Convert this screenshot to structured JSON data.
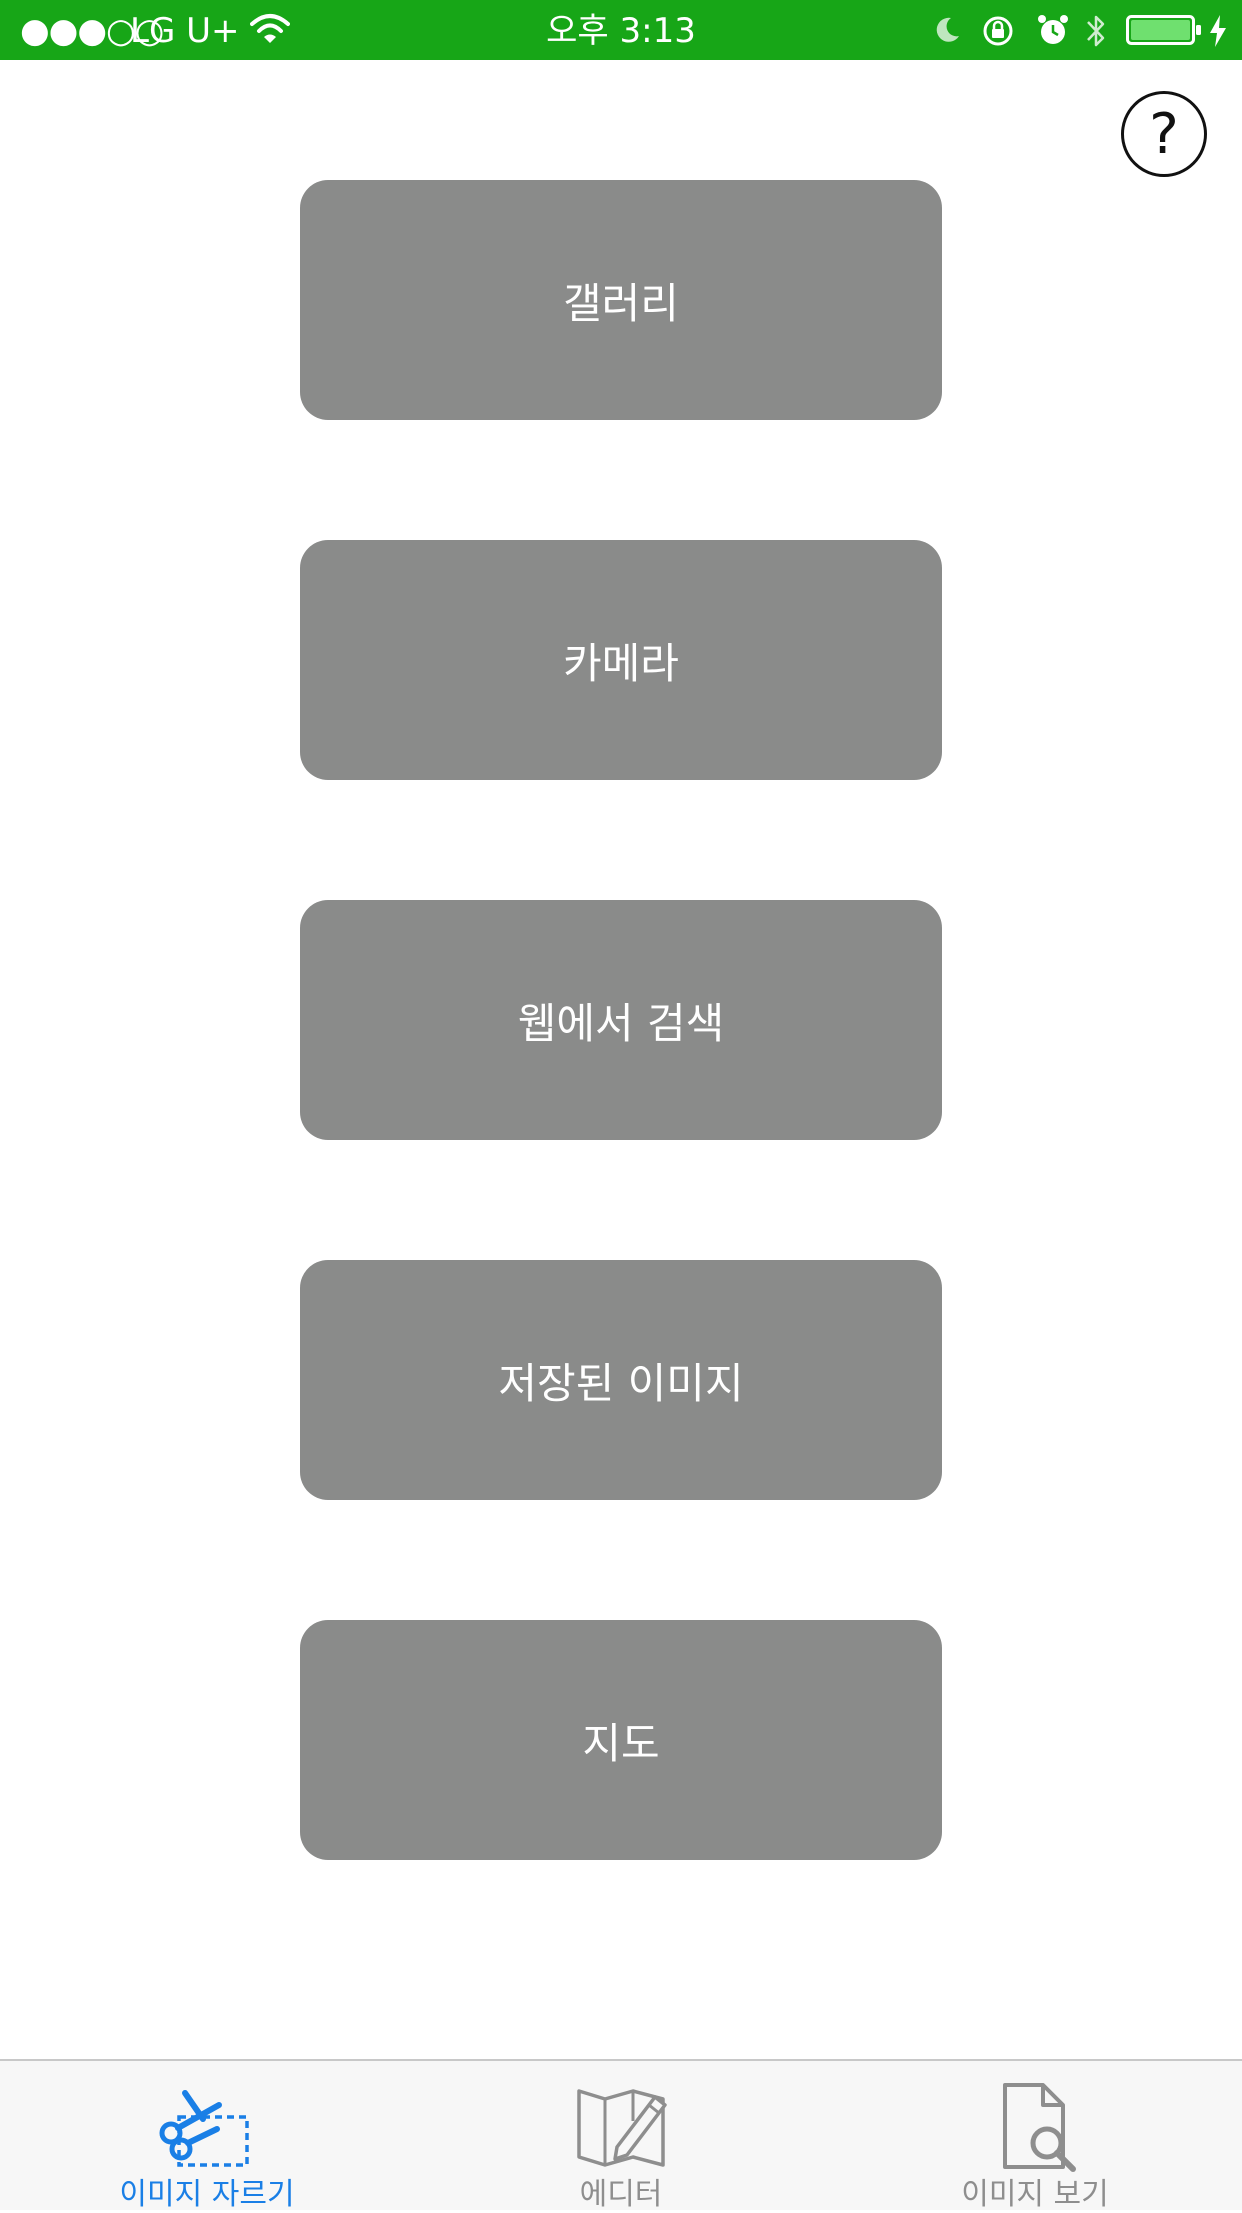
{
  "status_bar": {
    "signal": "●●●○○",
    "carrier": "LG U+",
    "time": "오후 3:13",
    "background_color": "#17a617",
    "icons": [
      "wifi-icon",
      "moon-icon",
      "orientation-lock-icon",
      "alarm-icon",
      "bluetooth-icon",
      "battery-icon",
      "charging-icon"
    ]
  },
  "help": {
    "label": "?"
  },
  "menu": {
    "gallery": "갤러리",
    "camera": "카메라",
    "web_search": "웹에서 검색",
    "saved_images": "저장된 이미지",
    "map": "지도"
  },
  "tabs": {
    "crop": {
      "label": "이미지 자르기",
      "icon": "scissors-crop-icon",
      "selected": true
    },
    "editor": {
      "label": "에디터",
      "icon": "map-pencil-icon",
      "selected": false
    },
    "viewer": {
      "label": "이미지 보기",
      "icon": "document-search-icon",
      "selected": false
    }
  },
  "colors": {
    "button_gray": "#8a8b8a",
    "tab_active": "#1a7fe6",
    "tab_inactive": "#8e8e8e"
  }
}
